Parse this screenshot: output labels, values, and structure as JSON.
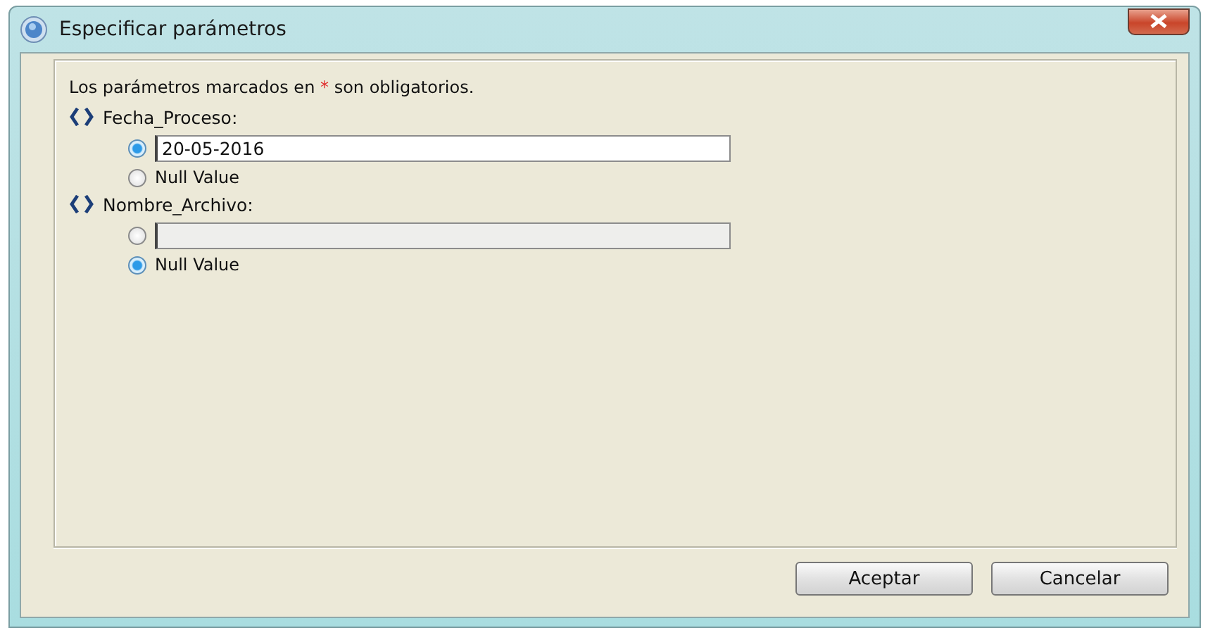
{
  "window": {
    "title": "Especificar parámetros"
  },
  "note": {
    "before": "Los parámetros marcados en",
    "mark": "*",
    "after": "son obligatorios."
  },
  "parameters": [
    {
      "name": "Fecha_Proceso:",
      "value_option": {
        "selected": true,
        "value": "20-05-2016",
        "disabled": false
      },
      "null_option": {
        "label": "Null Value",
        "selected": false
      }
    },
    {
      "name": "Nombre_Archivo:",
      "value_option": {
        "selected": false,
        "disabled": true
      },
      "null_option": {
        "label": "Null Value",
        "selected": true
      }
    }
  ],
  "buttons": [
    "Aceptar",
    "Cancelar"
  ]
}
